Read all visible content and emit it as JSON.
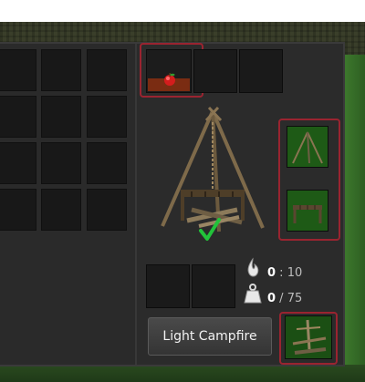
{
  "colors": {
    "highlight_border": "#9a2430",
    "panel_bg": "#2b2b2b",
    "slot_bg": "#181818",
    "recipe_slot_bg": "#1e5a16",
    "check_green": "#22c23a",
    "counter_value": "#ffffff",
    "counter_max": "#bdbdbd"
  },
  "campfire": {
    "fuel": {
      "current": "0",
      "separator": " : ",
      "max": "10"
    },
    "cooking": {
      "current": "0",
      "separator": " / ",
      "max": "75"
    },
    "light_button_label": "Light Campfire"
  },
  "icons": {
    "food_slot": "apple-icon",
    "fuel_indicator": "fuel-flame-icon",
    "weight_indicator": "weight-icon",
    "ready": "checkmark-icon",
    "recipe_1": "tripod-icon",
    "recipe_2": "grill-rack-icon",
    "tool": "fire-drill-icon"
  }
}
